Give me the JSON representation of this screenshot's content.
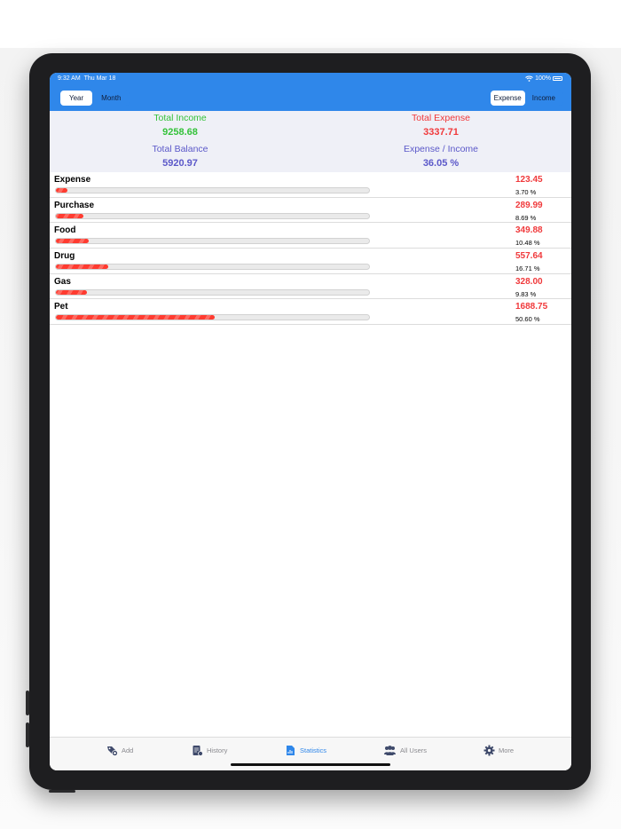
{
  "status": {
    "time": "9:32 AM",
    "date": "Thu Mar 18",
    "battery": "100%"
  },
  "period_segment": {
    "options": [
      "Year",
      "Month"
    ],
    "selected": "Year"
  },
  "type_segment": {
    "options": [
      "Expense",
      "Income"
    ],
    "selected": "Expense"
  },
  "summary": {
    "total_income_label": "Total Income",
    "total_income_value": "9258.68",
    "total_expense_label": "Total Expense",
    "total_expense_value": "3337.71",
    "total_balance_label": "Total Balance",
    "total_balance_value": "5920.97",
    "ratio_label": "Expense / Income",
    "ratio_value": "36.05 %"
  },
  "categories": [
    {
      "name": "Expense",
      "amount": "123.45",
      "percent_text": "3.70 %",
      "fraction": 0.037
    },
    {
      "name": "Purchase",
      "amount": "289.99",
      "percent_text": "8.69 %",
      "fraction": 0.0869
    },
    {
      "name": "Food",
      "amount": "349.88",
      "percent_text": "10.48 %",
      "fraction": 0.1048
    },
    {
      "name": "Drug",
      "amount": "557.64",
      "percent_text": "16.71 %",
      "fraction": 0.1671
    },
    {
      "name": "Gas",
      "amount": "328.00",
      "percent_text": "9.83 %",
      "fraction": 0.0983
    },
    {
      "name": "Pet",
      "amount": "1688.75",
      "percent_text": "50.60 %",
      "fraction": 0.506
    }
  ],
  "tabbar": {
    "items": [
      {
        "label": "Add",
        "icon": "add-tag-icon"
      },
      {
        "label": "History",
        "icon": "history-icon"
      },
      {
        "label": "Statistics",
        "icon": "statistics-icon"
      },
      {
        "label": "All Users",
        "icon": "users-icon"
      },
      {
        "label": "More",
        "icon": "gear-icon"
      }
    ],
    "active": "Statistics"
  },
  "colors": {
    "accent": "#2f87ea",
    "income": "#34c23a",
    "expense": "#f0393b",
    "balance": "#5b58c9"
  }
}
